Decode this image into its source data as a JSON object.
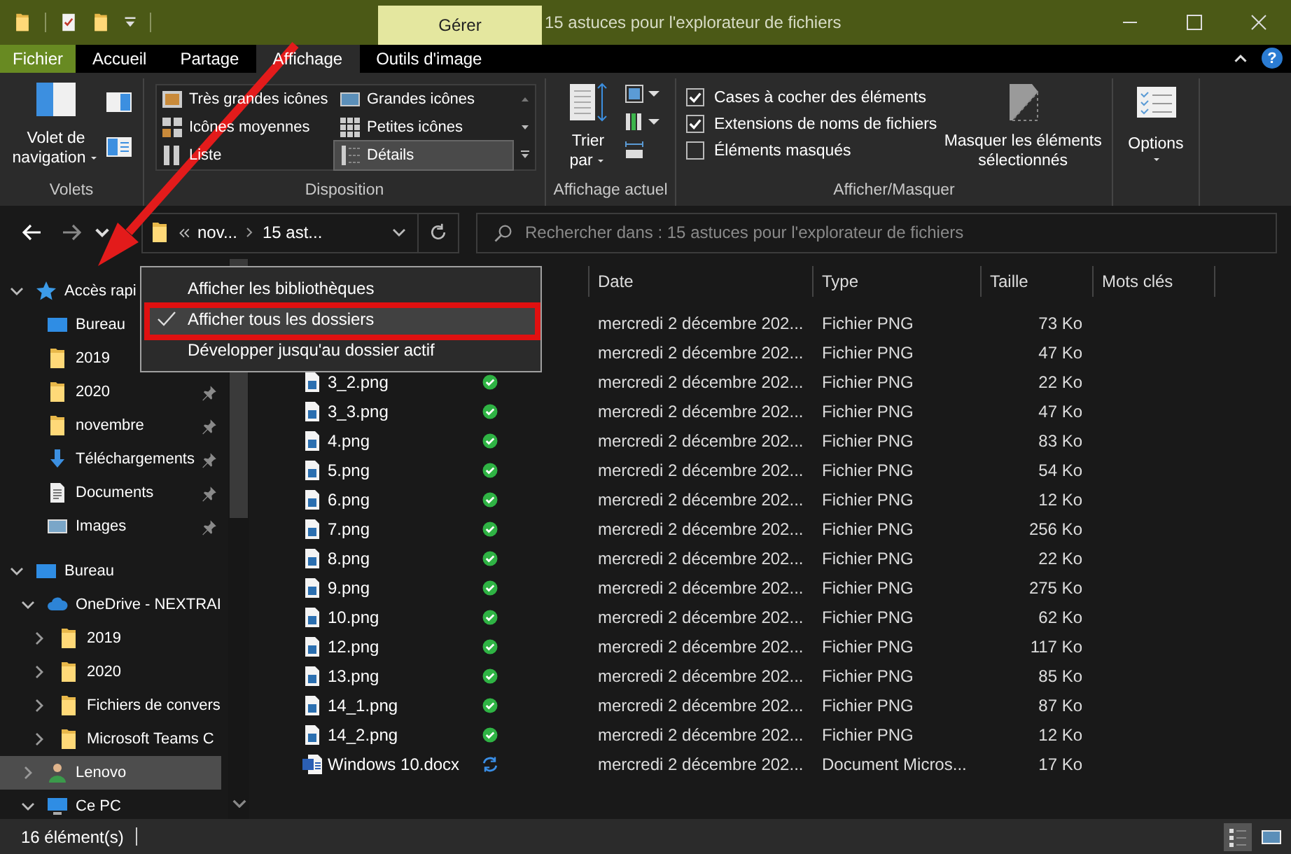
{
  "title_bar": {
    "context_tab": "Gérer",
    "title": "15 astuces pour l'explorateur de fichiers"
  },
  "ribbon_tabs": [
    {
      "label": "Fichier",
      "kind": "file",
      "selected": false
    },
    {
      "label": "Accueil",
      "kind": "tab",
      "selected": false
    },
    {
      "label": "Partage",
      "kind": "tab",
      "selected": false
    },
    {
      "label": "Affichage",
      "kind": "tab",
      "selected": true
    },
    {
      "label": "Outils d'image",
      "kind": "tab",
      "selected": false
    }
  ],
  "help": "?",
  "ribbon": {
    "panes": {
      "label": "Volets",
      "nav_button": "Volet de navigation"
    },
    "layout": {
      "label": "Disposition",
      "items": [
        {
          "label": "Très grandes icônes",
          "selected": false
        },
        {
          "label": "Grandes icônes",
          "selected": false
        },
        {
          "label": "Icônes moyennes",
          "selected": false
        },
        {
          "label": "Petites icônes",
          "selected": false
        },
        {
          "label": "Liste",
          "selected": false
        },
        {
          "label": "Détails",
          "selected": true
        }
      ]
    },
    "current_view": {
      "label": "Affichage actuel",
      "sort_button": "Trier par"
    },
    "show_hide": {
      "label": "Afficher/Masquer",
      "checkboxes": [
        {
          "label": "Cases à cocher des éléments",
          "checked": true
        },
        {
          "label": "Extensions de noms de fichiers",
          "checked": true
        },
        {
          "label": "Éléments masqués",
          "checked": false
        }
      ],
      "hide_button": "Masquer les éléments sélectionnés"
    },
    "options": {
      "button": "Options"
    }
  },
  "address_bar": {
    "segments": [
      "nov...",
      "15 ast..."
    ]
  },
  "search": {
    "placeholder": "Rechercher dans : 15 astuces pour l'explorateur de fichiers"
  },
  "nav_pane": {
    "items": [
      {
        "label": "Accès rapi",
        "kind": "star",
        "expanded": true,
        "selected": false,
        "children": [
          {
            "label": "Bureau",
            "kind": "desktop",
            "selected": false
          },
          {
            "label": "2019",
            "kind": "folder",
            "selected": false
          },
          {
            "label": "2020",
            "kind": "folder",
            "pinned": true,
            "selected": false
          },
          {
            "label": "novembre",
            "kind": "folder",
            "pinned": true,
            "selected": false
          },
          {
            "label": "Téléchargements",
            "kind": "download",
            "pinned": true,
            "selected": false
          },
          {
            "label": "Documents",
            "kind": "document",
            "pinned": true,
            "selected": false
          },
          {
            "label": "Images",
            "kind": "pictures",
            "pinned": true,
            "selected": false
          }
        ]
      },
      {
        "label": "Bureau",
        "kind": "desktop",
        "expanded": true,
        "selected": false,
        "children": [
          {
            "label": "OneDrive - NEXTRAI",
            "kind": "cloud",
            "expanded": true,
            "selected": false,
            "children": [
              {
                "label": "2019",
                "kind": "folder",
                "expanded": false,
                "selected": false
              },
              {
                "label": "2020",
                "kind": "folder",
                "expanded": false,
                "selected": false
              },
              {
                "label": "Fichiers de convers",
                "kind": "folder",
                "expanded": false,
                "selected": false
              },
              {
                "label": "Microsoft Teams C",
                "kind": "folder",
                "expanded": false,
                "selected": false
              }
            ]
          },
          {
            "label": "Lenovo",
            "kind": "user",
            "expanded": false,
            "selected": true
          },
          {
            "label": "Ce PC",
            "kind": "pc",
            "expanded": true,
            "selected": false
          }
        ]
      }
    ]
  },
  "file_list": {
    "columns": [
      {
        "label": "Date"
      },
      {
        "label": "Type"
      },
      {
        "label": "Taille"
      },
      {
        "label": "Mots clés"
      }
    ],
    "rows": [
      {
        "date": "mercredi 2 décembre 202...",
        "type": "Fichier PNG",
        "size": "73 Ko"
      },
      {
        "date": "mercredi 2 décembre 202...",
        "type": "Fichier PNG",
        "size": "47 Ko"
      },
      {
        "name": "3_2.png",
        "kind": "image",
        "synced": true,
        "date": "mercredi 2 décembre 202...",
        "type": "Fichier PNG",
        "size": "22 Ko"
      },
      {
        "name": "3_3.png",
        "kind": "image",
        "synced": true,
        "date": "mercredi 2 décembre 202...",
        "type": "Fichier PNG",
        "size": "47 Ko"
      },
      {
        "name": "4.png",
        "kind": "image",
        "synced": true,
        "date": "mercredi 2 décembre 202...",
        "type": "Fichier PNG",
        "size": "83 Ko"
      },
      {
        "name": "5.png",
        "kind": "image",
        "synced": true,
        "date": "mercredi 2 décembre 202...",
        "type": "Fichier PNG",
        "size": "54 Ko"
      },
      {
        "name": "6.png",
        "kind": "image",
        "synced": true,
        "date": "mercredi 2 décembre 202...",
        "type": "Fichier PNG",
        "size": "12 Ko"
      },
      {
        "name": "7.png",
        "kind": "image",
        "synced": true,
        "date": "mercredi 2 décembre 202...",
        "type": "Fichier PNG",
        "size": "256 Ko"
      },
      {
        "name": "8.png",
        "kind": "image",
        "synced": true,
        "date": "mercredi 2 décembre 202...",
        "type": "Fichier PNG",
        "size": "22 Ko"
      },
      {
        "name": "9.png",
        "kind": "image",
        "synced": true,
        "date": "mercredi 2 décembre 202...",
        "type": "Fichier PNG",
        "size": "275 Ko"
      },
      {
        "name": "10.png",
        "kind": "image",
        "synced": true,
        "date": "mercredi 2 décembre 202...",
        "type": "Fichier PNG",
        "size": "62 Ko"
      },
      {
        "name": "12.png",
        "kind": "image",
        "synced": true,
        "date": "mercredi 2 décembre 202...",
        "type": "Fichier PNG",
        "size": "117 Ko"
      },
      {
        "name": "13.png",
        "kind": "image",
        "synced": true,
        "date": "mercredi 2 décembre 202...",
        "type": "Fichier PNG",
        "size": "85 Ko"
      },
      {
        "name": "14_1.png",
        "kind": "image",
        "synced": true,
        "date": "mercredi 2 décembre 202...",
        "type": "Fichier PNG",
        "size": "87 Ko"
      },
      {
        "name": "14_2.png",
        "kind": "image",
        "synced": true,
        "date": "mercredi 2 décembre 202...",
        "type": "Fichier PNG",
        "size": "12 Ko"
      },
      {
        "name": "Windows 10.docx",
        "kind": "word",
        "synced": false,
        "date": "mercredi 2 décembre 202...",
        "type": "Document Micros...",
        "size": "17 Ko"
      }
    ]
  },
  "menu": {
    "items": [
      {
        "label": "Afficher les bibliothèques",
        "checked": false,
        "selected": false
      },
      {
        "label": "Afficher tous les dossiers",
        "checked": true,
        "selected": true
      },
      {
        "label": "Développer jusqu'au dossier actif",
        "checked": false,
        "selected": false
      }
    ]
  },
  "status_bar": {
    "count": "16 élément(s)",
    "views": [
      {
        "kind": "details",
        "selected": true
      },
      {
        "kind": "large_icons",
        "selected": false
      }
    ]
  }
}
